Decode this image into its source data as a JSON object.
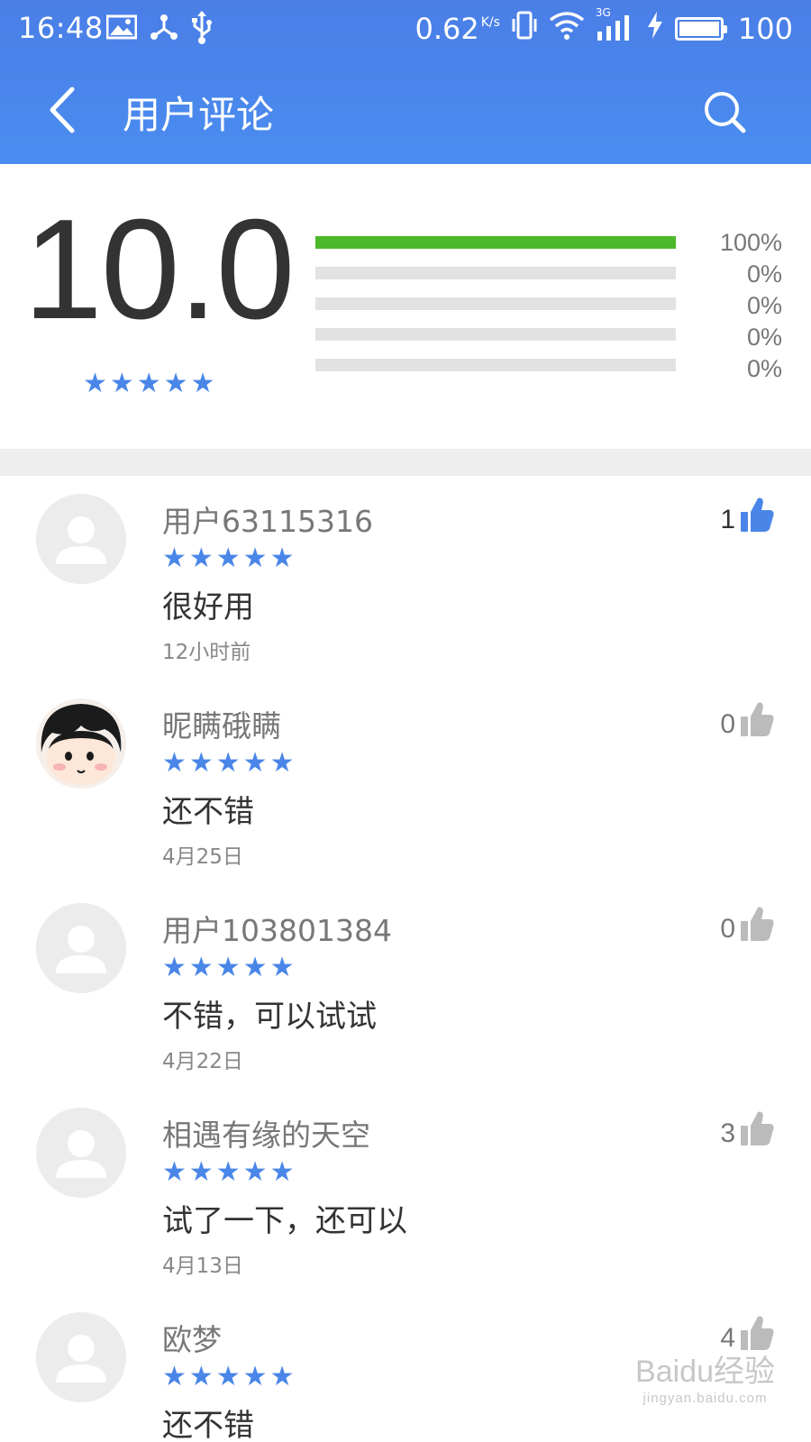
{
  "status_bar": {
    "time": "16:48",
    "speed": "0.62",
    "speed_unit": "K/s",
    "network": "3G",
    "battery": "100"
  },
  "navbar": {
    "title": "用户评论",
    "back_icon": "chevron-left-icon",
    "search_icon": "search-icon"
  },
  "summary": {
    "score": "10.0",
    "stars": "★★★★★",
    "rating_distribution": [
      {
        "percent": 100,
        "label": "100%"
      },
      {
        "percent": 0,
        "label": "0%"
      },
      {
        "percent": 0,
        "label": "0%"
      },
      {
        "percent": 0,
        "label": "0%"
      },
      {
        "percent": 0,
        "label": "0%"
      }
    ]
  },
  "reviews": [
    {
      "name": "用户63115316",
      "stars": "★★★★★",
      "text": "很好用",
      "date": "12小时前",
      "likes": "1",
      "liked": true,
      "avatar": "default"
    },
    {
      "name": "昵瞒硪瞒",
      "stars": "★★★★★",
      "text": "还不错",
      "date": "4月25日",
      "likes": "0",
      "liked": false,
      "avatar": "cartoon"
    },
    {
      "name": "用户103801384",
      "stars": "★★★★★",
      "text": "不错，可以试试",
      "date": "4月22日",
      "likes": "0",
      "liked": false,
      "avatar": "default"
    },
    {
      "name": "相遇有缘的天空",
      "stars": "★★★★★",
      "text": "试了一下，还可以",
      "date": "4月13日",
      "likes": "3",
      "liked": false,
      "avatar": "default"
    },
    {
      "name": "欧梦",
      "stars": "★★★★★",
      "text": "还不错",
      "date": "",
      "likes": "4",
      "liked": false,
      "avatar": "default"
    }
  ],
  "colors": {
    "header": "#4a86e8",
    "star": "#4a86e8",
    "bar_fill": "#4cb82a",
    "bar_track": "#e2e2e2",
    "like_active": "#4a86e8",
    "like_inactive": "#bbbbbb"
  },
  "watermark": {
    "brand": "Baidu经验",
    "url": "jingyan.baidu.com"
  }
}
